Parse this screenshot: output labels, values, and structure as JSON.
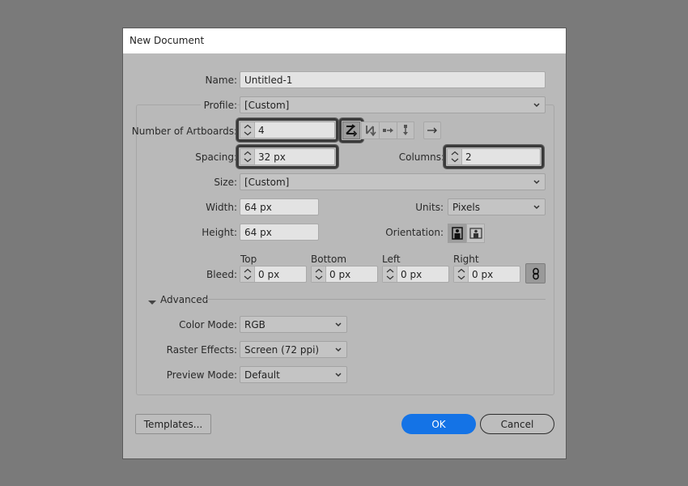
{
  "dialog": {
    "title": "New Document"
  },
  "form": {
    "name_label": "Name:",
    "name_value": "Untitled-1",
    "profile_label": "Profile:",
    "profile_value": "[Custom]",
    "artboards_label": "Number of Artboards:",
    "artboards_value": "4",
    "spacing_label": "Spacing:",
    "spacing_value": "32 px",
    "columns_label": "Columns:",
    "columns_value": "2",
    "size_label": "Size:",
    "size_value": "[Custom]",
    "width_label": "Width:",
    "width_value": "64 px",
    "units_label": "Units:",
    "units_value": "Pixels",
    "height_label": "Height:",
    "height_value": "64 px",
    "orientation_label": "Orientation:",
    "orientation_selected": "portrait",
    "bleed_label": "Bleed:",
    "bleed": [
      {
        "label": "Top",
        "value": "0 px"
      },
      {
        "label": "Bottom",
        "value": "0 px"
      },
      {
        "label": "Left",
        "value": "0 px"
      },
      {
        "label": "Right",
        "value": "0 px"
      }
    ],
    "bleed_linked": true
  },
  "arrangement": {
    "selected": "grid-by-row",
    "options": [
      "grid-by-row",
      "grid-by-column",
      "arrange-by-row",
      "arrange-by-column",
      "change-to-right-to-left"
    ]
  },
  "advanced": {
    "label": "Advanced",
    "expanded": true,
    "color_mode_label": "Color Mode:",
    "color_mode_value": "RGB",
    "raster_label": "Raster Effects:",
    "raster_value": "Screen (72 ppi)",
    "preview_label": "Preview Mode:",
    "preview_value": "Default"
  },
  "buttons": {
    "templates": "Templates...",
    "ok": "OK",
    "cancel": "Cancel"
  },
  "colors": {
    "accent": "#1473e6",
    "dialog_bg": "#b9b9b9",
    "backdrop": "#7a7a7a"
  }
}
